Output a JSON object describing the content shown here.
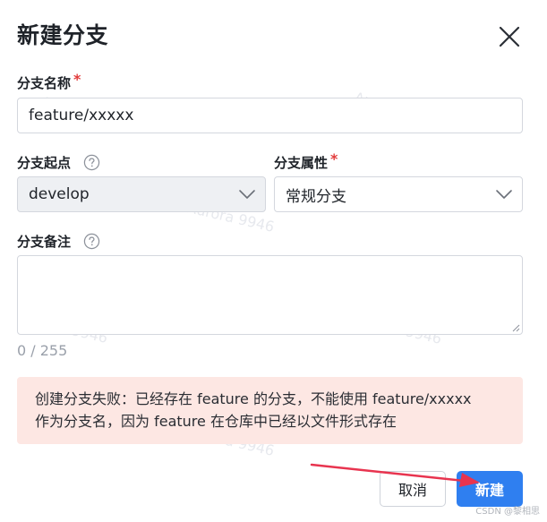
{
  "dialog": {
    "title": "新建分支"
  },
  "form": {
    "branch_name": {
      "label": "分支名称",
      "required_mark": "*",
      "value": "feature/xxxxx"
    },
    "branch_start": {
      "label": "分支起点",
      "value": "develop"
    },
    "branch_type": {
      "label": "分支属性",
      "required_mark": "*",
      "value": "常规分支"
    },
    "branch_note": {
      "label": "分支备注",
      "value": "",
      "counter": "0 / 255"
    }
  },
  "error": {
    "line1": "创建分支失败：已经存在 feature 的分支，不能使用 feature/xxxxx",
    "line2": "作为分支名，因为 feature 在仓库中已经以文件形式存在"
  },
  "buttons": {
    "cancel_label": "取消",
    "create_label": "新建"
  },
  "watermark": {
    "text": "Aurora 9946"
  },
  "credit": "CSDN @黎相思",
  "colors": {
    "primary": "#2f7ff0",
    "required": "#e23b3b",
    "error_bg": "#fde7e3",
    "arrow": "#e8344f"
  },
  "icons": {
    "close": "close-icon",
    "help": "question-circle-icon",
    "chevron": "chevron-down-icon"
  }
}
